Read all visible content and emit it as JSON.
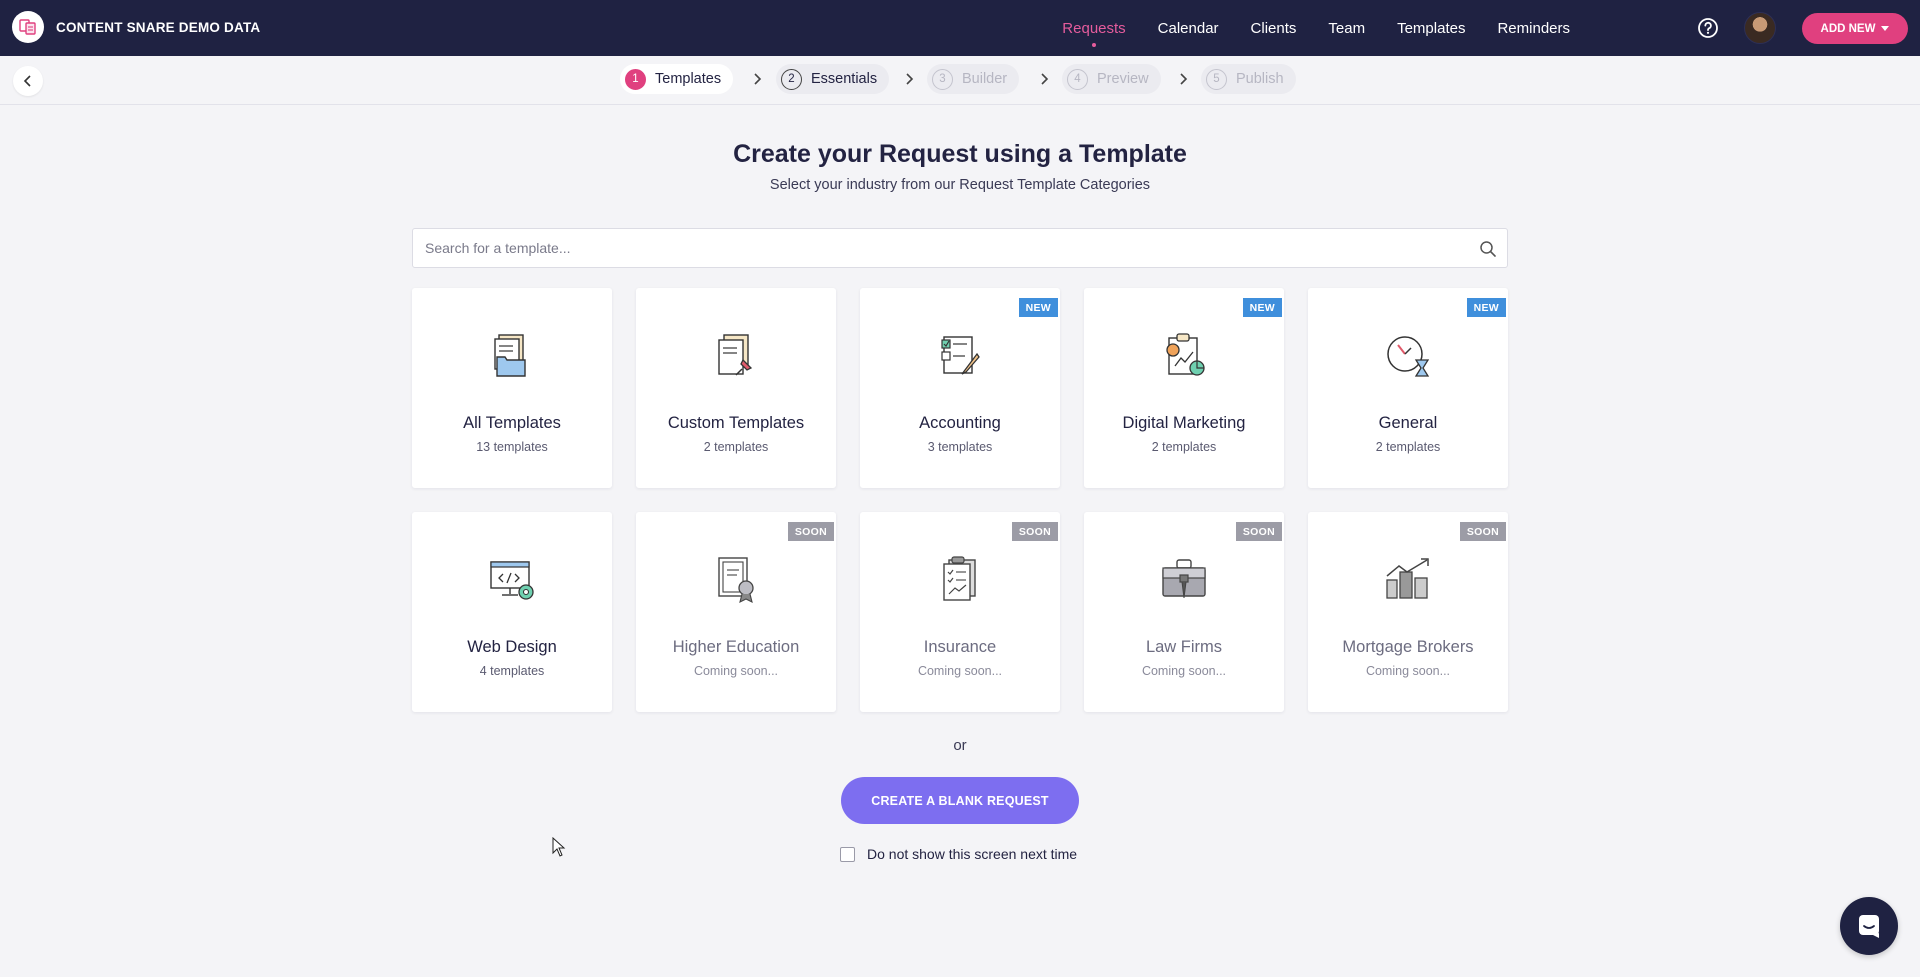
{
  "header": {
    "brand": "CONTENT SNARE DEMO DATA",
    "nav": [
      {
        "label": "Requests",
        "active": true
      },
      {
        "label": "Calendar"
      },
      {
        "label": "Clients"
      },
      {
        "label": "Team"
      },
      {
        "label": "Templates"
      },
      {
        "label": "Reminders"
      }
    ],
    "help_icon": "question-circle-icon",
    "add_new_label": "ADD NEW",
    "accent_color": "#e0407f",
    "background_color": "#1f2242"
  },
  "stepper": {
    "steps": [
      {
        "num": "1",
        "label": "Templates",
        "state": "active"
      },
      {
        "num": "2",
        "label": "Essentials",
        "state": "done"
      },
      {
        "num": "3",
        "label": "Builder",
        "state": "todo"
      },
      {
        "num": "4",
        "label": "Preview",
        "state": "todo"
      },
      {
        "num": "5",
        "label": "Publish",
        "state": "todo"
      }
    ]
  },
  "main": {
    "title": "Create your Request using a Template",
    "subtitle": "Select your industry from our Request Template Categories",
    "search_placeholder": "Search for a template...",
    "categories": [
      {
        "name": "All Templates",
        "count": "13 templates",
        "badge": "",
        "icon": "folder-documents-icon"
      },
      {
        "name": "Custom Templates",
        "count": "2 templates",
        "badge": "",
        "icon": "pinned-documents-icon"
      },
      {
        "name": "Accounting",
        "count": "3 templates",
        "badge": "NEW",
        "icon": "checklist-pencil-icon"
      },
      {
        "name": "Digital Marketing",
        "count": "2 templates",
        "badge": "NEW",
        "icon": "clipboard-chart-icon"
      },
      {
        "name": "General",
        "count": "2 templates",
        "badge": "NEW",
        "icon": "clock-hourglass-icon"
      },
      {
        "name": "Web Design",
        "count": "4 templates",
        "badge": "",
        "icon": "monitor-code-gear-icon"
      },
      {
        "name": "Higher Education",
        "count": "Coming soon...",
        "badge": "SOON",
        "icon": "certificate-icon"
      },
      {
        "name": "Insurance",
        "count": "Coming soon...",
        "badge": "SOON",
        "icon": "policy-documents-icon"
      },
      {
        "name": "Law Firms",
        "count": "Coming soon...",
        "badge": "SOON",
        "icon": "briefcase-icon"
      },
      {
        "name": "Mortgage Brokers",
        "count": "Coming soon...",
        "badge": "SOON",
        "icon": "city-chart-icon"
      }
    ],
    "or_text": "or",
    "blank_button": "CREATE A BLANK REQUEST",
    "blank_button_color": "#7d6ef0",
    "dont_show_label": "Do not show this screen next time",
    "new_badge_color": "#3f8fdc",
    "soon_badge_color": "#9c9ca6"
  }
}
